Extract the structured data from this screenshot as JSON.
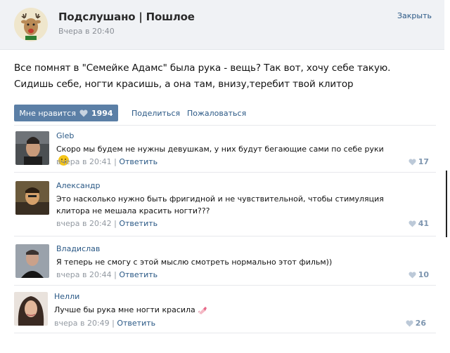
{
  "header": {
    "group_name": "Подслушано | Пошлое",
    "time": "Вчера в 20:40",
    "close_label": "Закрыть"
  },
  "post": {
    "lines": [
      "Все помнят в \"Семейке Адамс\" была рука - вещь? Так вот, хочу себе такую.",
      "Сидишь себе, ногти красишь, а она там, внизу,теребит твой клитор"
    ],
    "like_label": "Мне нравится",
    "like_count": "1994",
    "share_label": "Поделиться",
    "report_label": "Пожаловаться"
  },
  "comments": [
    {
      "author": "Gleb",
      "text": "Скоро мы будем не нужны девушкам, у них будут бегающие сами по себе руки",
      "time": "вчера в 20:41",
      "reply_label": "Ответить",
      "likes": "17",
      "emoji": "smile-emoji"
    },
    {
      "author": "Александр",
      "text": "Это насколько нужно быть фригидной и не чувствительной, чтобы стимуляция клитора не мешала красить ногти???",
      "time": "вчера в 20:42",
      "reply_label": "Ответить",
      "likes": "41"
    },
    {
      "author": "Владислав",
      "text": "Я теперь не смогу с этой мыслю смотреть нормально этот фильм))",
      "time": "вчера в 20:44",
      "reply_label": "Ответить",
      "likes": "10"
    },
    {
      "author": "Нелли",
      "text": "Лучше бы рука мне ногти красила",
      "time": "вчера в 20:49",
      "reply_label": "Ответить",
      "likes": "26",
      "emoji": "nail-polish-emoji"
    }
  ],
  "colors": {
    "link": "#2a5885",
    "like_button": "#5b7fa6",
    "meta": "#939aa2",
    "header_bg": "#f0f2f5"
  },
  "icons": [
    "heart-icon",
    "reindeer-avatar",
    "smile-emoji",
    "nail-polish-emoji"
  ]
}
